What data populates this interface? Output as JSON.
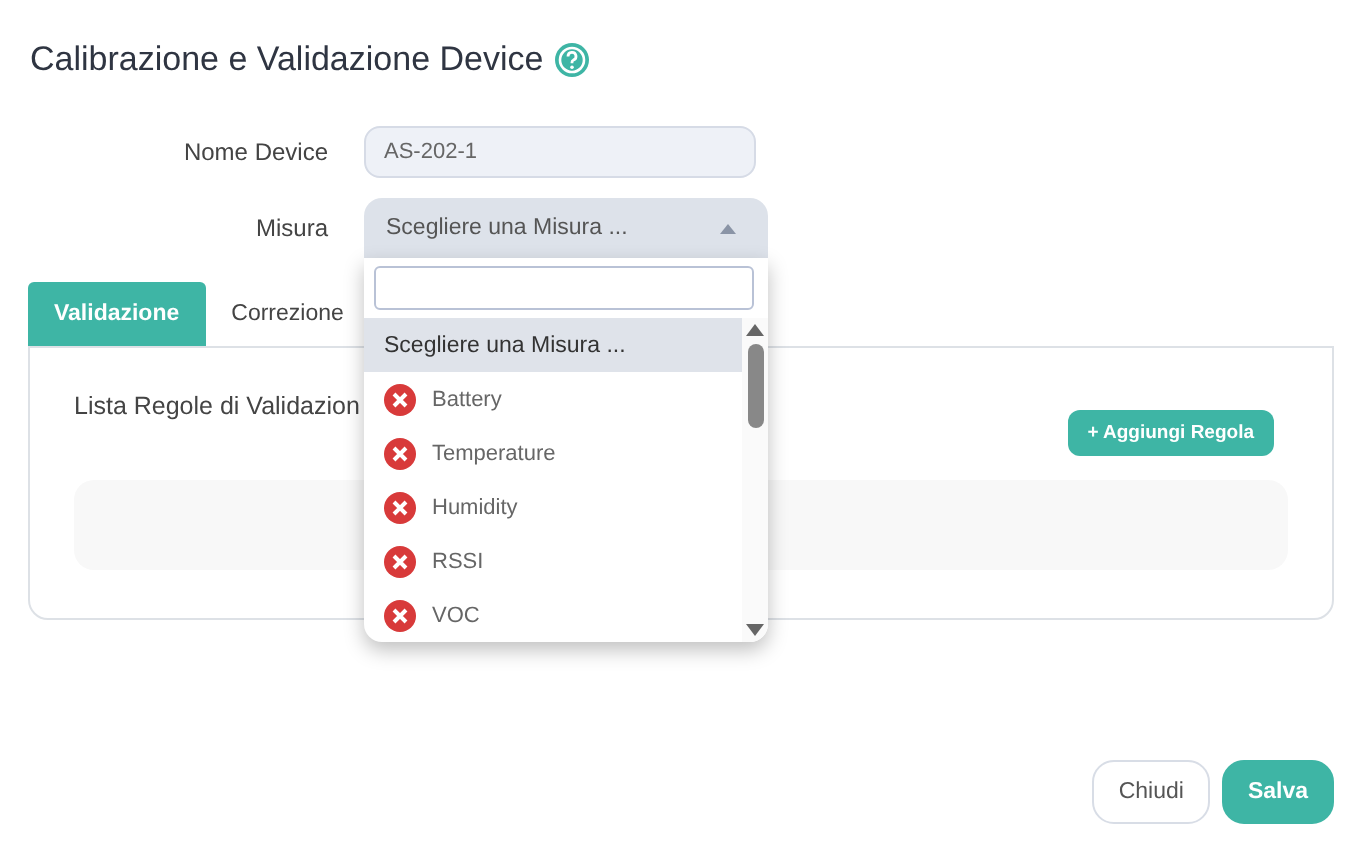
{
  "title": "Calibrazione e Validazione Device",
  "fields": [
    {
      "label": "Nome Device",
      "value": "AS-202-1",
      "kind": "text"
    },
    {
      "label": "Misura",
      "value": "Scegliere una Misura ...",
      "kind": "select",
      "expanded": true
    }
  ],
  "tabs": [
    {
      "label": "Validazione",
      "selected": true
    },
    {
      "label": "Correzione",
      "selected": false
    }
  ],
  "panel": {
    "heading": "Lista Regole di Validazion",
    "add_button": "+ Aggiungi Regola"
  },
  "dropdown": {
    "options": [
      {
        "label": "Scegliere una Misura ...",
        "kind": "placeholder",
        "selected": true
      },
      {
        "label": "Battery",
        "kind": "option",
        "selected": false
      },
      {
        "label": "Temperature",
        "kind": "option",
        "selected": false
      },
      {
        "label": "Humidity",
        "kind": "option",
        "selected": false
      },
      {
        "label": "RSSI",
        "kind": "option",
        "selected": false
      },
      {
        "label": "VOC",
        "kind": "option",
        "selected": false
      }
    ]
  },
  "buttons": [
    {
      "label": "Chiudi",
      "kind": "secondary"
    },
    {
      "label": "Salva",
      "kind": "primary"
    }
  ]
}
